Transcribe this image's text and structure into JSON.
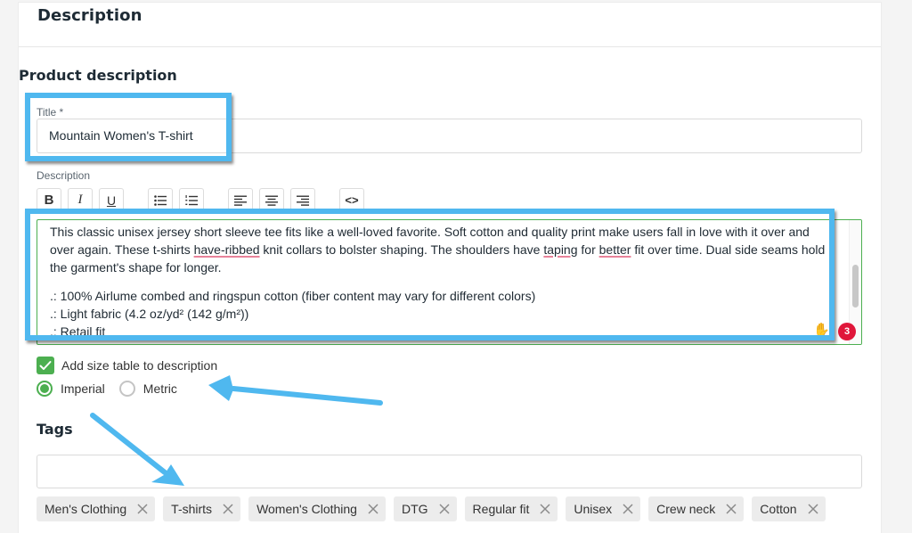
{
  "card": {
    "title": "Description"
  },
  "product_description": {
    "section_title": "Product description",
    "title_field": {
      "label": "Title *",
      "value": "Mountain Women's T-shirt"
    },
    "description_field": {
      "label": "Description",
      "toolbar": [
        {
          "name": "bold",
          "glyph": "B"
        },
        {
          "name": "italic",
          "glyph": "I"
        },
        {
          "name": "underline",
          "glyph": "U"
        },
        {
          "name": "bulleted-list",
          "glyph": ""
        },
        {
          "name": "numbered-list",
          "glyph": ""
        },
        {
          "name": "align-left",
          "glyph": ""
        },
        {
          "name": "align-center",
          "glyph": ""
        },
        {
          "name": "align-right",
          "glyph": ""
        },
        {
          "name": "source-code",
          "glyph": "<>"
        }
      ],
      "paragraph": {
        "part1": "This classic unisex jersey short sleeve tee fits like a well-loved favorite. Soft cotton and quality print make users fall in love with it over and over again. These t-shirts ",
        "spell1": "have-ribbed",
        "part2": " knit collars to bolster shaping. The shoulders have ",
        "spell2": "taping",
        "part3": " for ",
        "spell3": "better",
        "part4": " fit over time. Dual side seams hold the garment's shape for longer."
      },
      "list_lines": [
        ".: 100% Airlume combed and ringspun cotton (fiber content may vary for different colors)",
        ".: Light fabric (4.2 oz/yd² (142 g/m²))",
        ".: Retail fit"
      ],
      "error_badge_count": "3",
      "scroll_position": 0.55
    },
    "size_table": {
      "checkbox_label": "Add size table to description",
      "checked": true,
      "units": [
        {
          "label": "Imperial",
          "selected": true
        },
        {
          "label": "Metric",
          "selected": false
        }
      ]
    }
  },
  "tags": {
    "title": "Tags",
    "input_value": "",
    "items": [
      "Men's Clothing",
      "T-shirts",
      "Women's Clothing",
      "DTG",
      "Regular fit",
      "Unisex",
      "Crew neck",
      "Cotton"
    ]
  },
  "colors": {
    "accent_green": "#4caf50",
    "annotation_blue": "#4fb8ef",
    "badge_red": "#e0163a"
  }
}
